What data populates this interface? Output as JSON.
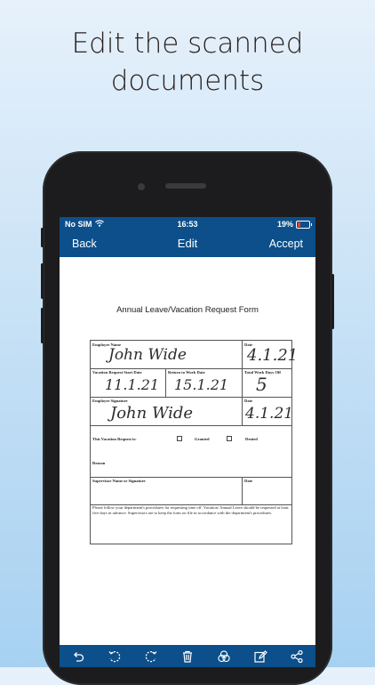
{
  "headline": {
    "line1": "Edit the scanned",
    "line2": "documents"
  },
  "status_bar": {
    "carrier": "No SIM",
    "time": "16:53",
    "battery": "19%",
    "battery_color": "#ff3b30"
  },
  "nav": {
    "back": "Back",
    "title": "Edit",
    "accept": "Accept"
  },
  "document": {
    "title": "Annual Leave/Vacation Request Form",
    "employee_name_label": "Employee Name",
    "employee_name_value": "John Wide",
    "date_label": "Date",
    "date_value_1": "4.1.21",
    "start_date_label": "Vacation Request Start Date",
    "start_date_value": "11.1.21",
    "return_date_label": "Return to Work Date",
    "return_date_value": "15.1.21",
    "total_days_label": "Total Work Days Off",
    "total_days_value": "5",
    "signature_label": "Employee Signature",
    "signature_value": "John Wide",
    "date_value_2": "4.1.21",
    "request_is_label": "This Vacation Request is:",
    "granted_label": "Granted",
    "denied_label": "Denied",
    "reason_label": "Reason",
    "supervisor_label": "Supervisor Name or Signature",
    "note": "Please follow your department's procedures for requesting time off. Vacation/ Annual Leave should be requested at least five days in advance. Supervisors are to keep the form on file in accordance with the department's procedures."
  },
  "toolbar": {
    "icons": [
      "undo-icon",
      "rotate-left-icon",
      "rotate-right-icon",
      "trash-icon",
      "filter-icon",
      "edit-icon",
      "share-icon"
    ]
  },
  "colors": {
    "nav_blue": "#0c4f8a",
    "phone_frame": "#1c1c1e"
  }
}
